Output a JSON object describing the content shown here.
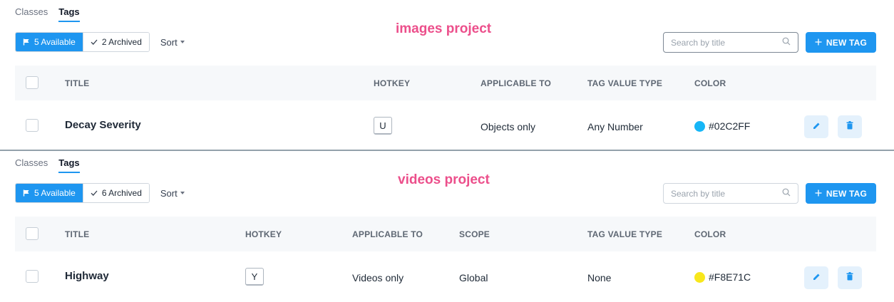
{
  "panels": [
    {
      "tabs": [
        "Classes",
        "Tags"
      ],
      "active_tab": "Tags",
      "project_label": "images project",
      "filters": {
        "available": "5 Available",
        "archived": "2 Archived",
        "sort": "Sort"
      },
      "search": {
        "placeholder": "Search by title"
      },
      "new_button": "NEW TAG",
      "columns": [
        "TITLE",
        "HOTKEY",
        "APPLICABLE TO",
        "TAG VALUE TYPE",
        "COLOR"
      ],
      "row": {
        "title": "Decay Severity",
        "hotkey": "U",
        "applicable_to": "Objects only",
        "tag_value_type": "Any Number",
        "color": "#02C2FF",
        "color_swatch": "#16b6f7"
      }
    },
    {
      "tabs": [
        "Classes",
        "Tags"
      ],
      "active_tab": "Tags",
      "project_label": "videos project",
      "filters": {
        "available": "5 Available",
        "archived": "6 Archived",
        "sort": "Sort"
      },
      "search": {
        "placeholder": "Search by title"
      },
      "new_button": "NEW TAG",
      "columns": [
        "TITLE",
        "HOTKEY",
        "APPLICABLE TO",
        "SCOPE",
        "TAG VALUE TYPE",
        "COLOR"
      ],
      "row": {
        "title": "Highway",
        "hotkey": "Y",
        "applicable_to": "Videos only",
        "scope": "Global",
        "tag_value_type": "None",
        "color": "#F8E71C",
        "color_swatch": "#f8e71c"
      }
    }
  ],
  "icons": {
    "available": "flag-icon",
    "archived": "check-icon",
    "search": "search-icon",
    "new": "plus-icon",
    "edit": "pencil-icon",
    "delete": "trash-icon"
  },
  "colors": {
    "accent": "#1e96f0",
    "project_label": "#ec4f8b",
    "action_bg": "#e4f1fc"
  }
}
